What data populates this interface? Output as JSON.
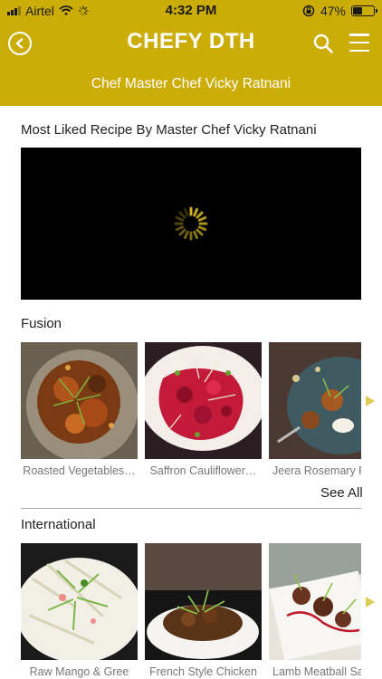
{
  "status_bar": {
    "carrier": "Airtel",
    "time": "4:32 PM",
    "battery_percent": "47%",
    "battery_level": 0.47
  },
  "header": {
    "title": "CHEFY DTH",
    "subtitle": "Chef Master Chef Vicky Ratnani",
    "background_color": "#ccad08"
  },
  "featured": {
    "heading": "Most Liked Recipe By Master Chef Vicky Ratnani"
  },
  "sections": [
    {
      "title": "Fusion",
      "see_all_label": "See All",
      "items": [
        {
          "label": "Roasted Vegetables…"
        },
        {
          "label": "Saffron Cauliflower…"
        },
        {
          "label": "Jeera Rosemary Ro"
        }
      ]
    },
    {
      "title": "International",
      "items": [
        {
          "label": "Raw Mango & Gree"
        },
        {
          "label": "French Style Chicken"
        },
        {
          "label": "Lamb Meatball Sal"
        }
      ]
    }
  ]
}
